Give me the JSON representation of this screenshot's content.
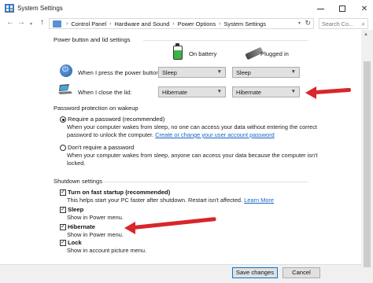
{
  "window": {
    "title": "System Settings"
  },
  "address": {
    "crumbs": [
      "Control Panel",
      "Hardware and Sound",
      "Power Options",
      "System Settings"
    ],
    "search_placeholder": "Search Co..."
  },
  "power_buttons": {
    "section_title": "Power button and lid settings",
    "col_battery": "On battery",
    "col_plugged": "Plugged in",
    "rows": [
      {
        "label": "When I press the power button:",
        "battery": "Sleep",
        "plugged": "Sleep"
      },
      {
        "label": "When I close the lid:",
        "battery": "Hibernate",
        "plugged": "Hibernate"
      }
    ]
  },
  "password": {
    "section_title": "Password protection on wakeup",
    "option_require": "Require a password (recommended)",
    "option_require_desc_1": "When your computer wakes from sleep, no one can access your data without entering the correct",
    "option_require_desc_2": "password to unlock the computer.",
    "option_require_link": "Create or change your user account password",
    "option_none": "Don't require a password",
    "option_none_desc_1": "When your computer wakes from sleep, anyone can access your data because the computer isn't",
    "option_none_desc_2": "locked.",
    "selected": "require"
  },
  "shutdown": {
    "section_title": "Shutdown settings",
    "items": [
      {
        "label": "Turn on fast startup (recommended)",
        "desc": "This helps start your PC faster after shutdown. Restart isn't affected.",
        "link": "Learn More",
        "checked": true
      },
      {
        "label": "Sleep",
        "desc": "Show in Power menu.",
        "checked": true
      },
      {
        "label": "Hibernate",
        "desc": "Show in Power menu.",
        "checked": true
      },
      {
        "label": "Lock",
        "desc": "Show in account picture menu.",
        "checked": true
      }
    ]
  },
  "footer": {
    "save_label": "Save changes",
    "cancel_label": "Cancel"
  },
  "colors": {
    "annotation_arrow": "#d8262b",
    "link": "#1a63c6",
    "accent": "#0078d7"
  }
}
